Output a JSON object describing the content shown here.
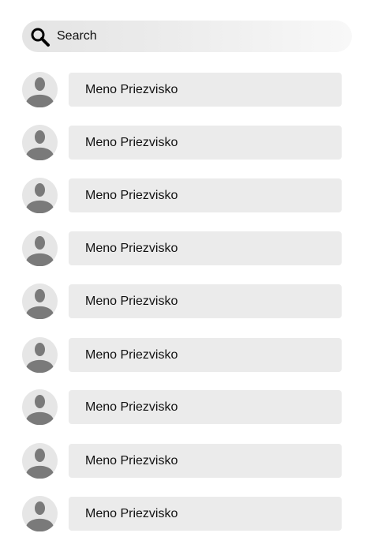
{
  "search": {
    "placeholder": "Search",
    "icon": "search-icon"
  },
  "contacts": [
    {
      "name": "Meno Priezvisko",
      "avatar_icon": "user-avatar-icon"
    },
    {
      "name": "Meno Priezvisko",
      "avatar_icon": "user-avatar-icon"
    },
    {
      "name": "Meno Priezvisko",
      "avatar_icon": "user-avatar-icon"
    },
    {
      "name": "Meno Priezvisko",
      "avatar_icon": "user-avatar-icon"
    },
    {
      "name": "Meno Priezvisko",
      "avatar_icon": "user-avatar-icon"
    },
    {
      "name": "Meno Priezvisko",
      "avatar_icon": "user-avatar-icon"
    },
    {
      "name": "Meno Priezvisko",
      "avatar_icon": "user-avatar-icon"
    },
    {
      "name": "Meno Priezvisko",
      "avatar_icon": "user-avatar-icon"
    },
    {
      "name": "Meno Priezvisko",
      "avatar_icon": "user-avatar-icon"
    }
  ],
  "colors": {
    "row_background": "#ebebeb",
    "avatar_background": "#e6e6e6",
    "avatar_figure": "#7a7a7a"
  }
}
